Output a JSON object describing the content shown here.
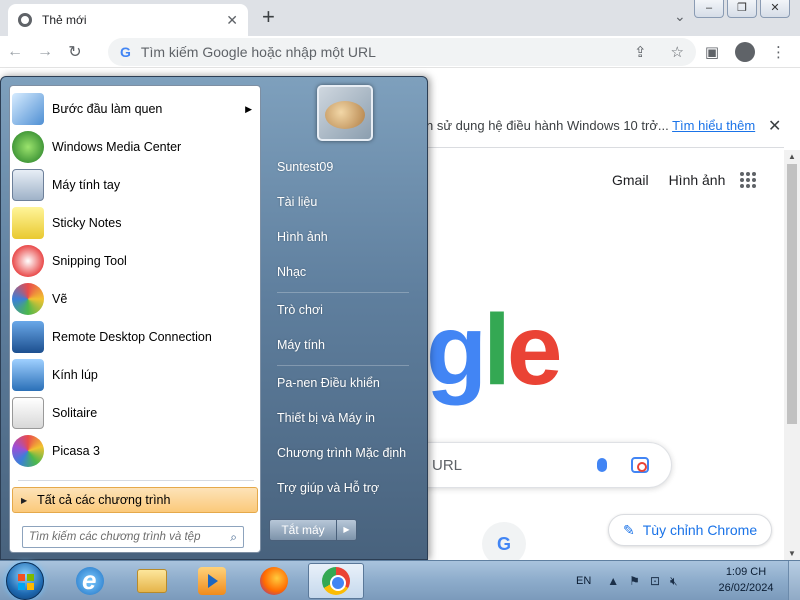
{
  "browser": {
    "tab_title": "Thẻ mới",
    "tab_close": "✕",
    "new_tab": "+",
    "tab_search": "⌄",
    "omnibox_placeholder": "Tìm kiếm Google hoặc nhập một URL",
    "infobar_message": "n sử dụng hệ điều hành Windows 10 trở...",
    "infobar_link": "Tìm hiểu thêm",
    "infobar_close": "✕",
    "header_links": [
      "Gmail",
      "Hình ảnh"
    ],
    "search_text": "URL",
    "logo_letters": {
      "g": "g",
      "l": "l",
      "e": "e"
    },
    "shortcut_letter": "G",
    "customize_label": "Tùy chỉnh Chrome"
  },
  "start_menu": {
    "programs": [
      {
        "label": "Bước đầu làm quen",
        "icon": "getting-started-icon",
        "has_arrow": true
      },
      {
        "label": "Windows Media Center",
        "icon": "media-center-icon"
      },
      {
        "label": "Máy tính tay",
        "icon": "calculator-icon"
      },
      {
        "label": "Sticky Notes",
        "icon": "sticky-notes-icon"
      },
      {
        "label": "Snipping Tool",
        "icon": "snipping-tool-icon"
      },
      {
        "label": "Vẽ",
        "icon": "paint-icon"
      },
      {
        "label": "Remote Desktop Connection",
        "icon": "remote-desktop-icon"
      },
      {
        "label": "Kính lúp",
        "icon": "magnifier-icon"
      },
      {
        "label": "Solitaire",
        "icon": "solitaire-icon"
      },
      {
        "label": "Picasa 3",
        "icon": "picasa-icon"
      }
    ],
    "all_programs": "Tất cả các chương trình",
    "search_placeholder": "Tìm kiếm các chương trình và tệp",
    "right_items": [
      "Suntest09",
      "Tài liệu",
      "Hình ảnh",
      "Nhạc",
      "Trò chơi",
      "Máy tính",
      "Pa-nen Điều khiển",
      "Thiết bị và Máy in",
      "Chương trình Mặc định",
      "Trợ giúp và Hỗ trợ"
    ],
    "shutdown_label": "Tắt máy",
    "shutdown_arrow": "▶"
  },
  "taskbar": {
    "apps": [
      "internet-explorer-icon",
      "windows-explorer-icon",
      "media-player-icon",
      "firefox-icon",
      "chrome-icon"
    ],
    "language": "EN",
    "time": "1:09 CH",
    "date": "26/02/2024"
  },
  "colors": {
    "chrome_blue": "#1a73e8",
    "google_blue": "#4285f4",
    "google_green": "#34a853",
    "google_red": "#ea4335",
    "all_programs_highlight": "#fbc97a"
  }
}
